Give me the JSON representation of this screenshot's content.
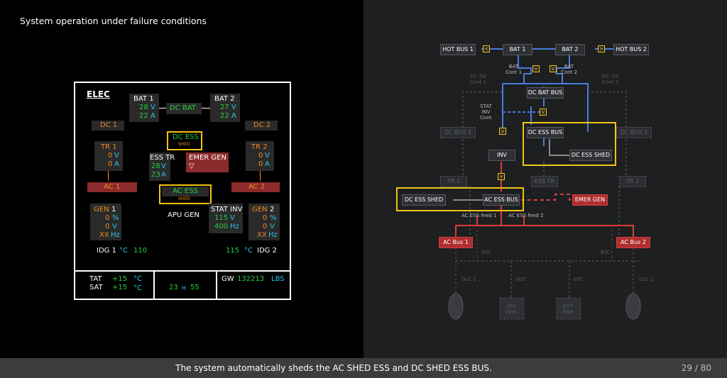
{
  "slide": {
    "title": "System operation under failure conditions",
    "caption": "The system automatically sheds the AC SHED ESS and DC SHED ESS BUS.",
    "page": "29 / 80"
  },
  "ecam": {
    "title": "ELEC",
    "bat1": {
      "label": "BAT 1",
      "volts": "28",
      "amps": "22",
      "v": "V",
      "a": "A"
    },
    "bat2": {
      "label": "BAT 2",
      "volts": "27",
      "amps": "22",
      "v": "V",
      "a": "A"
    },
    "dc_bat": "DC BAT",
    "dc1": "DC 1",
    "dc2": "DC 2",
    "dc_ess": "DC ESS",
    "dc_ess_shed": "SHED",
    "tr1": {
      "label": "TR 1",
      "volts": "0",
      "amps": "0",
      "v": "V",
      "a": "A"
    },
    "tr2": {
      "label": "TR 2",
      "volts": "0",
      "amps": "0",
      "v": "V",
      "a": "A"
    },
    "ess_tr": {
      "label": "ESS TR",
      "volts": "28",
      "amps": "23",
      "v": "V",
      "a": "A"
    },
    "emer_gen": "EMER GEN",
    "emer_gen_symbol": "▽",
    "ac1": "AC 1",
    "ac2": "AC 2",
    "ac_ess": "AC ESS",
    "ac_ess_shed": "SHED",
    "gen1": {
      "label": "GEN",
      "num": "1",
      "pct": "0",
      "volts": "0",
      "hz": "XX",
      "pct_u": "%",
      "v": "V",
      "hz_u": "Hz"
    },
    "gen2": {
      "label": "GEN",
      "num": "2",
      "pct": "0",
      "volts": "0",
      "hz": "XX",
      "pct_u": "%",
      "v": "V",
      "hz_u": "Hz"
    },
    "apu_gen": "APU GEN",
    "stat_inv": {
      "label": "STAT INV",
      "volts": "115",
      "hz": "400",
      "v": "V",
      "hz_u": "Hz"
    },
    "idg1": {
      "label": "IDG 1",
      "unit": "°C",
      "temp": "110"
    },
    "idg2": {
      "label": "IDG 2",
      "unit": "°C",
      "temp": "115"
    },
    "tat": {
      "label": "TAT",
      "value": "+15",
      "unit": "°C"
    },
    "sat": {
      "label": "SAT",
      "value": "+15",
      "unit": "°C"
    },
    "time": {
      "hours": "23",
      "sep": "H",
      "minutes": "55"
    },
    "gw": {
      "label": "GW",
      "value": "132213",
      "unit": "LBS"
    }
  },
  "diagram": {
    "hot_bus_1": "HOT BUS 1",
    "hot_bus_2": "HOT BUS 2",
    "bat_1": "BAT 1",
    "bat_2": "BAT 2",
    "bat_cont_1": "BAT\nCont 1",
    "bat_cont_2": "BAT\nCont 2",
    "dc_tie_cont_1": "DC Tie\nCont 1",
    "dc_tie_cont_2": "DC Tie\nCont 2",
    "dc_bat_bus": "DC BAT BUS",
    "stat_inv_cont": "STAT\nINV\nCont",
    "dc_bus_1": "DC BUS 1",
    "dc_bus_2": "DC BUS 2",
    "dc_ess_bus": "DC ESS BUS",
    "dc_ess_shed": "DC ESS SHED",
    "inv": "INV",
    "tr_1": "TR 1",
    "ess_tr": "ESS TR",
    "tr_2": "TR 2",
    "ac_dc_ess_shed": "DC ESS SHED",
    "ac_ess_bus": "AC ESS BUS",
    "emer_gen": "EMER GEN",
    "ac_ess_feed_1": "AC ESS feed 1",
    "ac_ess_feed_2": "AC ESS feed 2",
    "ac_bus_1": "AC Bus 1",
    "ac_bus_2": "AC Bus 2",
    "gtc": "GTC",
    "btc": "BTC",
    "glc_1": "GLC 1",
    "agc": "AGC",
    "epc": "EPC",
    "glc_2": "GLC 2",
    "apu_gen": "APU\nGEN",
    "ext_pwr": "EXT\nPWR",
    "colors": {
      "dc": "#4a7de0",
      "ac": "#e03a3a",
      "highlight": "#f2c40f"
    }
  }
}
